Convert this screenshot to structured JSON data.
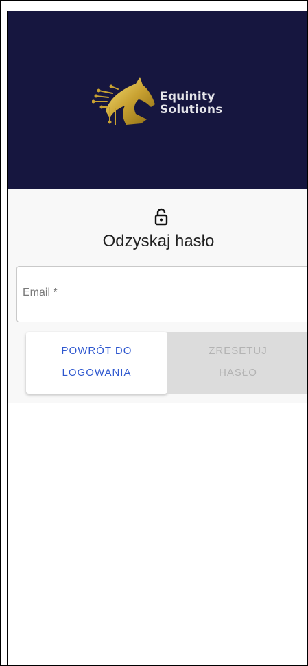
{
  "brand": {
    "line1": "Equinity",
    "line2": "Solutions",
    "header_color": "#16163f",
    "logo_icon": "horse-head-gold-icon"
  },
  "form": {
    "lock_icon": "lock-open-icon",
    "title": "Odzyskaj hasło",
    "email_label": "Email *"
  },
  "buttons": {
    "back_line1": "POWRÓT DO",
    "back_line2": "LOGOWANIA",
    "reset_line1": "ZRESETUJ",
    "reset_line2": "HASŁO",
    "accent": "#2f58cf"
  }
}
